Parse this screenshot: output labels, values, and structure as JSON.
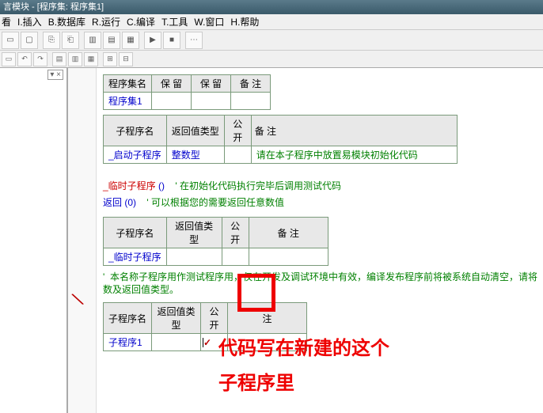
{
  "title": "言模块 - [程序集: 程序集1]",
  "menu": {
    "view": "看",
    "insert": "I.插入",
    "db": "B.数据库",
    "run": "R.运行",
    "compile": "C.编译",
    "tools": "T.工具",
    "window": "W.窗口",
    "help": "H.帮助"
  },
  "table1": {
    "h1": "程序集名",
    "h2": "保  留",
    "h3": "保  留",
    "h4": "备  注",
    "r1c1": "程序集1"
  },
  "table2": {
    "h1": "子程序名",
    "h2": "返回值类型",
    "h3": "公开",
    "h4": "备  注",
    "r1c1": "_启动子程序",
    "r1c2": "整数型",
    "r1c4": "请在本子程序中放置易模块初始化代码"
  },
  "code": {
    "line1a": "_临时子程序",
    "line1b": "()",
    "line1c": "'  在初始化代码执行完毕后调用测试代码",
    "line2a": "返回",
    "line2b": "(0)",
    "line2c": "'  可以根据您的需要返回任意数值"
  },
  "table3": {
    "h1": "子程序名",
    "h2": "返回值类型",
    "h3": "公开",
    "h4": "备  注",
    "r1c1": "_临时子程序"
  },
  "note": "'  本名称子程序用作测试程序用，仅在开发及调试环境中有效，编译发布程序前将被系统自动清空，请将\n数及返回值类型。",
  "table4": {
    "h1": "子程序名",
    "h2": "返回值类型",
    "h3": "公开",
    "h4": "注",
    "r1c1": "子程序1",
    "check": "✓"
  },
  "annotation": {
    "line1": "代码写在新建的这个",
    "line2": "子程序里"
  },
  "leftpane_close": "▾ ×"
}
